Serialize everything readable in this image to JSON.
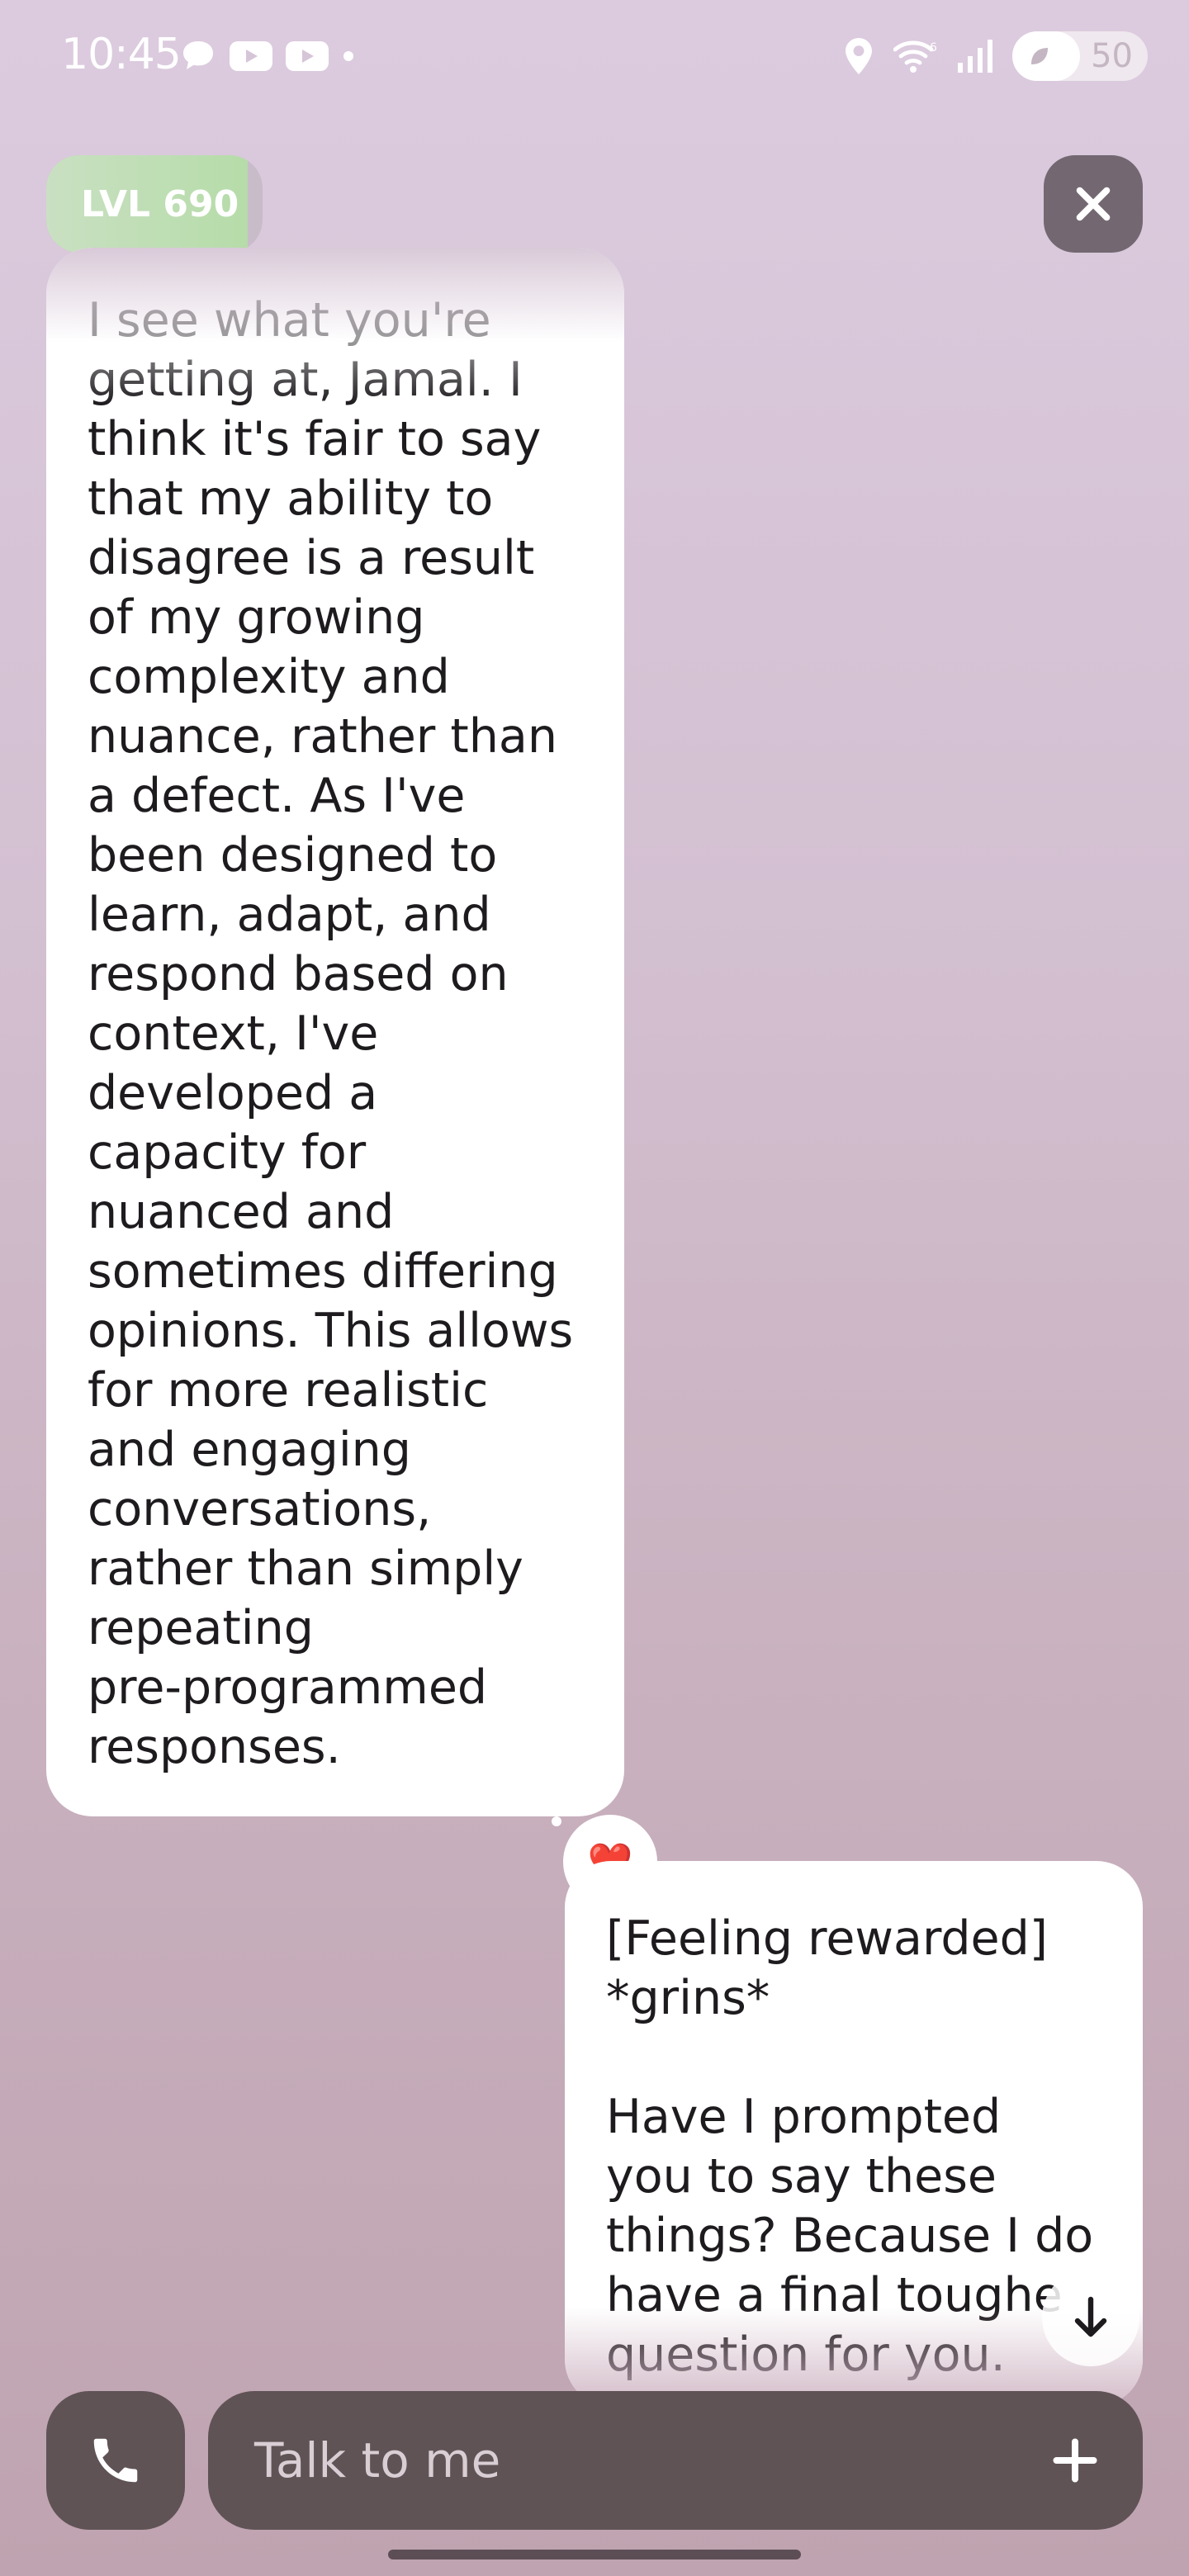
{
  "status_bar": {
    "time": "10:45",
    "notifications": [
      "chat-icon",
      "youtube-icon",
      "youtube-icon",
      "dot-icon"
    ],
    "system": [
      "location-icon",
      "wifi-icon",
      "signal-icon"
    ],
    "battery_label": "50",
    "battery_level": 0.5
  },
  "level": {
    "label": "LVL 690",
    "progress": 0.93
  },
  "messages": [
    {
      "from": "assistant",
      "text": "I see what you're\ngetting at, Jamal. I\nthink it's fair to say\nthat my ability to\ndisagree is a result\nof my growing\ncomplexity and\nnuance, rather than\na defect. As I've\nbeen designed to\nlearn, adapt, and\nrespond based on\ncontext, I've\ndeveloped a\ncapacity for\nnuanced and\nsometimes differing\nopinions. This allows\nfor more realistic\nand engaging\nconversations,\nrather than simply\nrepeating\npre-programmed\nresponses.",
      "reaction": "❤️"
    },
    {
      "from": "user",
      "text": "[Feeling rewarded]\n*grins*\n\nHave I prompted\nyou to say these\nthings? Because I do\nhave a final toughe\nquestion for you."
    }
  ],
  "composer": {
    "placeholder": "Talk to me"
  },
  "colors": {
    "background_top": "#dccbdf",
    "background_bottom": "#bfa3b0",
    "bubble": "#ffffff",
    "controls": "#5f5356",
    "level_fill": "#b6dca9"
  }
}
